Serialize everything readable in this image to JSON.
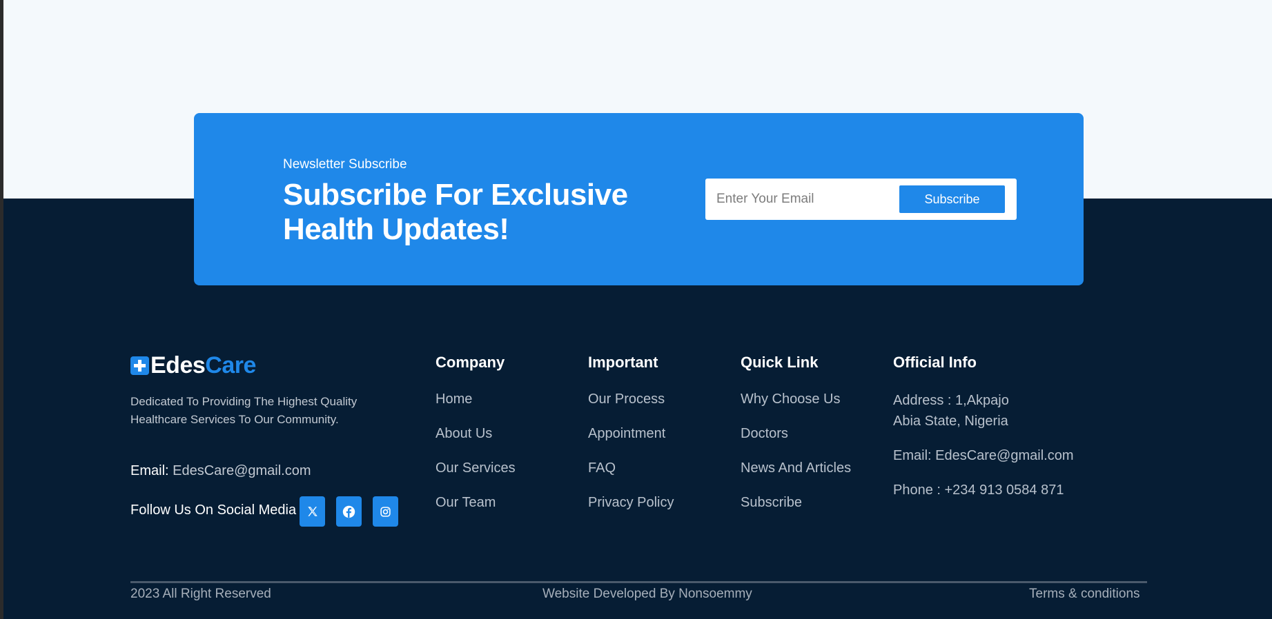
{
  "newsletter": {
    "kicker": "Newsletter Subscribe",
    "title": "Subscribe For Exclusive Health Updates!",
    "email_placeholder": "Enter Your Email",
    "button_label": "Subscribe"
  },
  "brand": {
    "name_part1": "Edes",
    "name_part2": "Care",
    "tagline": "Dedicated To Providing The Highest Quality Healthcare Services To Our Community.",
    "email_label": "Email:",
    "email_value": "EdesCare@gmail.com",
    "social_text": "Follow Us On Social Media",
    "social_icons": [
      "x-icon",
      "facebook-icon",
      "instagram-icon"
    ]
  },
  "columns": {
    "company": {
      "title": "Company",
      "links": [
        "Home",
        "About Us",
        "Our Services",
        "Our Team"
      ]
    },
    "important": {
      "title": "Important",
      "links": [
        "Our Process",
        "Appointment",
        "FAQ",
        "Privacy Policy"
      ]
    },
    "quick": {
      "title": "Quick Link",
      "links": [
        "Why Choose Us",
        "Doctors",
        "News And Articles",
        "Subscribe"
      ]
    },
    "official": {
      "title": "Official Info",
      "address_line1": "Address : 1,Akpajo",
      "address_line2": "Abia State, Nigeria",
      "email": "Email: EdesCare@gmail.com",
      "phone": "Phone : +234 913 0584 871"
    }
  },
  "bottom": {
    "copyright": "2023 All Right Reserved",
    "developer": "Website Developed By Nonsoemmy",
    "terms": "Terms & conditions"
  },
  "colors": {
    "accent": "#1f88e9",
    "footer_bg": "#061d34",
    "page_bg": "#f4f9fc"
  }
}
